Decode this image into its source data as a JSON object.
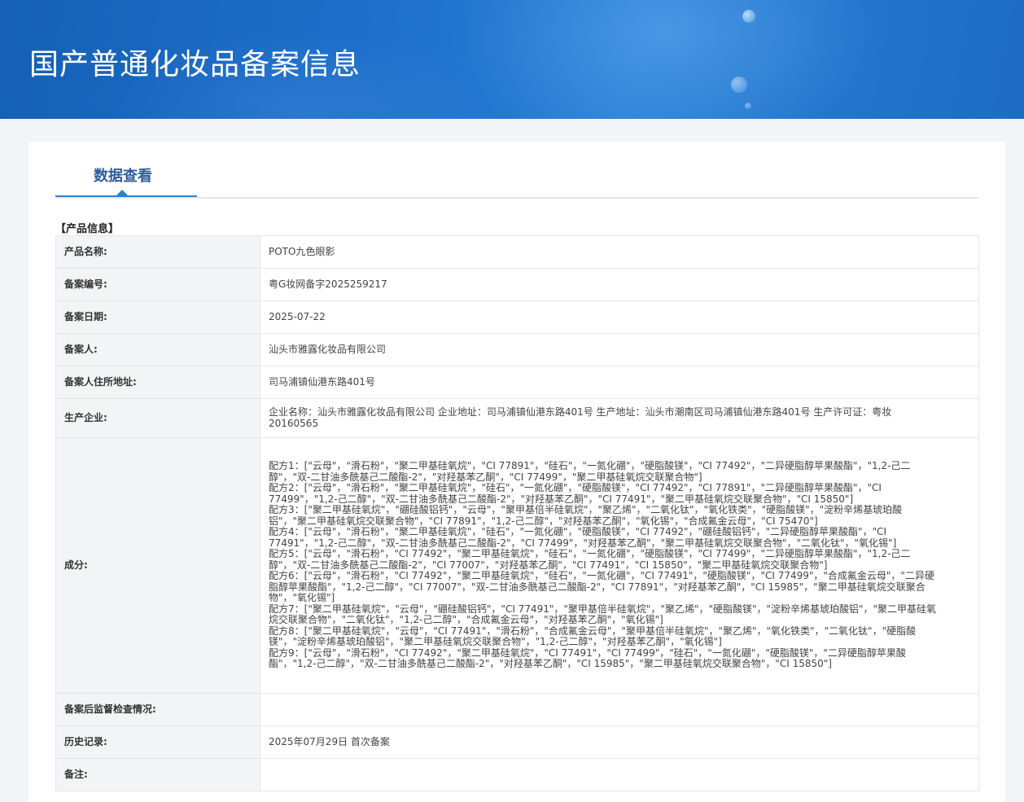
{
  "header": {
    "title": "国产普通化妆品备案信息"
  },
  "tabs": [
    {
      "label": "数据查看",
      "active": true
    }
  ],
  "section_title": "【产品信息】",
  "rows": {
    "product_name": {
      "label": "产品名称:",
      "value": "POTO九色眼影"
    },
    "record_no": {
      "label": "备案编号:",
      "value": "粤G妆网备字2025259217"
    },
    "record_date": {
      "label": "备案日期:",
      "value": "2025-07-22"
    },
    "registrant": {
      "label": "备案人:",
      "value": "汕头市雅露化妆品有限公司"
    },
    "registrant_address": {
      "label": "备案人住所地址:",
      "value": "司马浦镇仙港东路401号"
    },
    "manufacturer": {
      "label": "生产企业:",
      "value": "企业名称：汕头市雅露化妆品有限公司 企业地址：司马浦镇仙港东路401号 生产地址：汕头市潮南区司马浦镇仙港东路401号 生产许可证：粤妆20160565"
    },
    "ingredients": {
      "label": "成分:",
      "formulas": [
        "配方1：[\"云母\"，\"滑石粉\"，\"聚二甲基硅氧烷\"，\"CI 77891\"，\"硅石\"，\"一氮化硼\"，\"硬脂酸镁\"，\"CI 77492\"，\"二异硬脂醇苹果酸酯\"，\"1,2-己二醇\"，\"双-二甘油多酰基己二酸酯-2\"，\"对羟基苯乙酮\"，\"CI 77499\"，\"聚二甲基硅氧烷交联聚合物\"]",
        "配方2：[\"云母\"，\"滑石粉\"，\"聚二甲基硅氧烷\"，\"硅石\"，\"一氮化硼\"，\"硬脂酸镁\"，\"CI 77492\"，\"CI 77891\"，\"二异硬脂醇苹果酸酯\"，\"CI 77499\"，\"1,2-己二醇\"，\"双-二甘油多酰基己二酸酯-2\"，\"对羟基苯乙酮\"，\"CI 77491\"，\"聚二甲基硅氧烷交联聚合物\"，\"CI 15850\"]",
        "配方3：[\"聚二甲基硅氧烷\"，\"硼硅酸铝钙\"，\"云母\"，\"聚甲基倍半硅氧烷\"，\"聚乙烯\"，\"二氧化钛\"，\"氧化铁类\"，\"硬脂酸镁\"，\"淀粉辛烯基琥珀酸铝\"，\"聚二甲基硅氧烷交联聚合物\"，\"CI 77891\"，\"1,2-己二醇\"，\"对羟基苯乙酮\"，\"氧化锡\"，\"合成氟金云母\"，\"CI 75470\"]",
        "配方4：[\"云母\"，\"滑石粉\"，\"聚二甲基硅氧烷\"，\"硅石\"，\"一氮化硼\"，\"硬脂酸镁\"，\"CI 77492\"，\"硼硅酸铝钙\"，\"二异硬脂醇苹果酸酯\"，\"CI 77491\"，\"1,2-己二醇\"，\"双-二甘油多酰基己二酸酯-2\"，\"CI 77499\"，\"对羟基苯乙酮\"，\"聚二甲基硅氧烷交联聚合物\"，\"二氧化钛\"，\"氧化锡\"]",
        "配方5：[\"云母\"，\"滑石粉\"，\"CI 77492\"，\"聚二甲基硅氧烷\"，\"硅石\"，\"一氮化硼\"，\"硬脂酸镁\"，\"CI 77499\"，\"二异硬脂醇苹果酸酯\"，\"1,2-己二醇\"，\"双-二甘油多酰基己二酸酯-2\"，\"CI 77007\"，\"对羟基苯乙酮\"，\"CI 77491\"，\"CI 15850\"，\"聚二甲基硅氧烷交联聚合物\"]",
        "配方6：[\"云母\"，\"滑石粉\"，\"CI 77492\"，\"聚二甲基硅氧烷\"，\"硅石\"，\"一氮化硼\"，\"CI 77491\"，\"硬脂酸镁\"，\"CI 77499\"，\"合成氟金云母\"，\"二异硬脂醇苹果酸酯\"，\"1,2-己二醇\"，\"CI 77007\"，\"双-二甘油多酰基己二酸酯-2\"，\"CI 77891\"，\"对羟基苯乙酮\"，\"CI 15985\"，\"聚二甲基硅氧烷交联聚合物\"，\"氧化锡\"]",
        "配方7：[\"聚二甲基硅氧烷\"，\"云母\"，\"硼硅酸铝钙\"，\"CI 77491\"，\"聚甲基倍半硅氧烷\"，\"聚乙烯\"，\"硬脂酸镁\"，\"淀粉辛烯基琥珀酸铝\"，\"聚二甲基硅氧烷交联聚合物\"，\"二氧化钛\"，\"1,2-己二醇\"，\"合成氟金云母\"，\"对羟基苯乙酮\"，\"氧化锡\"]",
        "配方8：[\"聚二甲基硅氧烷\"，\"云母\"，\"CI 77491\"，\"滑石粉\"，\"合成氟金云母\"，\"聚甲基倍半硅氧烷\"，\"聚乙烯\"，\"氧化铁类\"，\"二氧化钛\"，\"硬脂酸镁\"，\"淀粉辛烯基琥珀酸铝\"，\"聚二甲基硅氧烷交联聚合物\"，\"1,2-己二醇\"，\"对羟基苯乙酮\"，\"氧化锡\"]",
        "配方9：[\"云母\"，\"滑石粉\"，\"CI 77492\"，\"聚二甲基硅氧烷\"，\"CI 77491\"，\"CI 77499\"，\"硅石\"，\"一氮化硼\"，\"硬脂酸镁\"，\"二异硬脂醇苹果酸酯\"，\"1,2-己二醇\"，\"双-二甘油多酰基己二酸酯-2\"，\"对羟基苯乙酮\"，\"CI 15985\"，\"聚二甲基硅氧烷交联聚合物\"，\"CI 15850\"]"
      ]
    },
    "post_supervision": {
      "label": "备案后监督检查情况:",
      "value": ""
    },
    "history": {
      "label": "历史记录:",
      "value": "2025年07月29日 首次备案"
    },
    "remarks": {
      "label": "备注:",
      "value": ""
    }
  },
  "colors": {
    "banner_blue": "#1d6fc9",
    "tab_accent": "#2f7fd1",
    "tab_text": "#2c5c9c",
    "table_border": "#9cbde2",
    "label_bg": "#f3f4f6"
  }
}
